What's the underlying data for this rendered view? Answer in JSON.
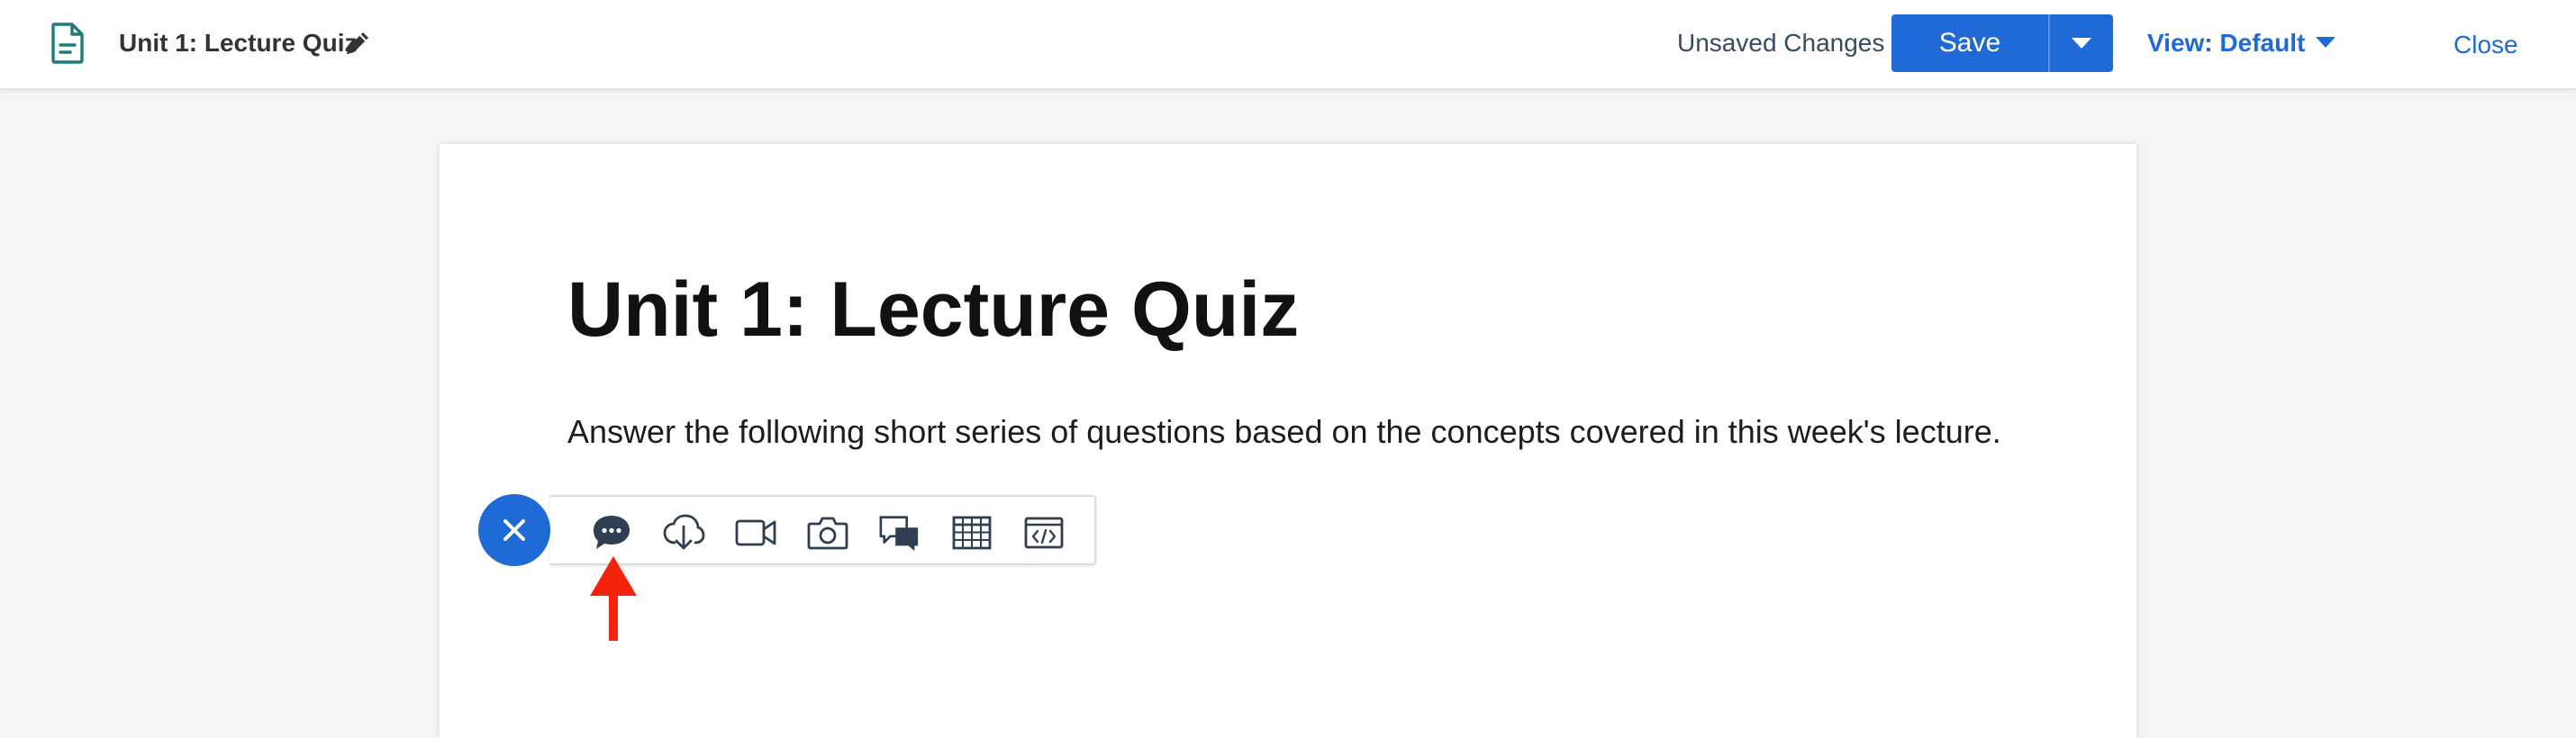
{
  "header": {
    "title": "Unit 1: Lecture Quiz",
    "status": "Unsaved Changes",
    "save_label": "Save",
    "view_label": "View: Default",
    "close_label": "Close"
  },
  "page": {
    "heading": "Unit 1: Lecture Quiz",
    "intro": "Answer the following short series of questions based on the concepts covered in this week's lecture."
  },
  "toolbar": {
    "items": [
      {
        "name": "chat-bubble-icon"
      },
      {
        "name": "download-cloud-icon"
      },
      {
        "name": "video-camera-icon"
      },
      {
        "name": "camera-icon"
      },
      {
        "name": "conversation-icon"
      },
      {
        "name": "table-grid-icon"
      },
      {
        "name": "embed-code-icon"
      }
    ]
  },
  "colors": {
    "accent": "#1f6ad6",
    "annotation_arrow": "#f5230b",
    "icon": "#2f3e50"
  }
}
